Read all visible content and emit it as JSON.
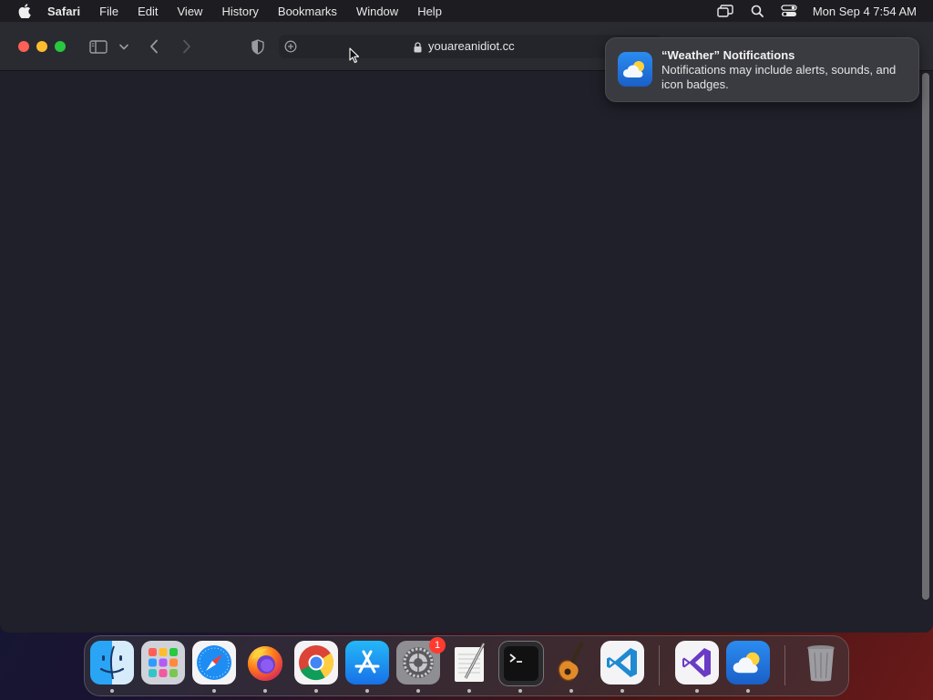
{
  "menubar": {
    "app_name": "Safari",
    "items": [
      "File",
      "Edit",
      "View",
      "History",
      "Bookmarks",
      "Window",
      "Help"
    ],
    "clock": "Mon Sep 4  7:54 AM",
    "status_icons": [
      "screen-mirroring-icon",
      "spotlight-search-icon",
      "control-center-icon"
    ]
  },
  "safari": {
    "url": "youareanidiot.cc",
    "toolbar_icons": [
      "sidebar-icon",
      "chevron-down-icon",
      "back-icon",
      "forward-icon",
      "privacy-shield-icon",
      "add-tab-icon",
      "lock-icon"
    ]
  },
  "notification": {
    "title": "“Weather” Notifications",
    "body": "Notifications may include alerts, sounds, and icon badges.",
    "icon": "weather-icon"
  },
  "dock": {
    "apps": [
      {
        "name": "Finder",
        "icon": "finder-icon",
        "running": true
      },
      {
        "name": "Launchpad",
        "icon": "launchpad-icon",
        "running": false
      },
      {
        "name": "Safari",
        "icon": "safari-icon",
        "running": true
      },
      {
        "name": "Firefox",
        "icon": "firefox-icon",
        "running": true
      },
      {
        "name": "Google Chrome",
        "icon": "chrome-icon",
        "running": true
      },
      {
        "name": "App Store",
        "icon": "app-store-icon",
        "running": true
      },
      {
        "name": "System Settings",
        "icon": "system-settings-icon",
        "running": true,
        "badge": "1"
      },
      {
        "name": "TextEdit",
        "icon": "textedit-icon",
        "running": true
      },
      {
        "name": "Terminal",
        "icon": "terminal-icon",
        "running": true
      },
      {
        "name": "GarageBand",
        "icon": "garageband-icon",
        "running": true
      },
      {
        "name": "Visual Studio Code",
        "icon": "vscode-icon",
        "running": true
      },
      {
        "name": "Visual Studio",
        "icon": "visual-studio-icon",
        "running": true
      },
      {
        "name": "Weather",
        "icon": "weather-icon",
        "running": true
      },
      {
        "name": "Trash",
        "icon": "trash-icon",
        "running": false
      }
    ]
  }
}
